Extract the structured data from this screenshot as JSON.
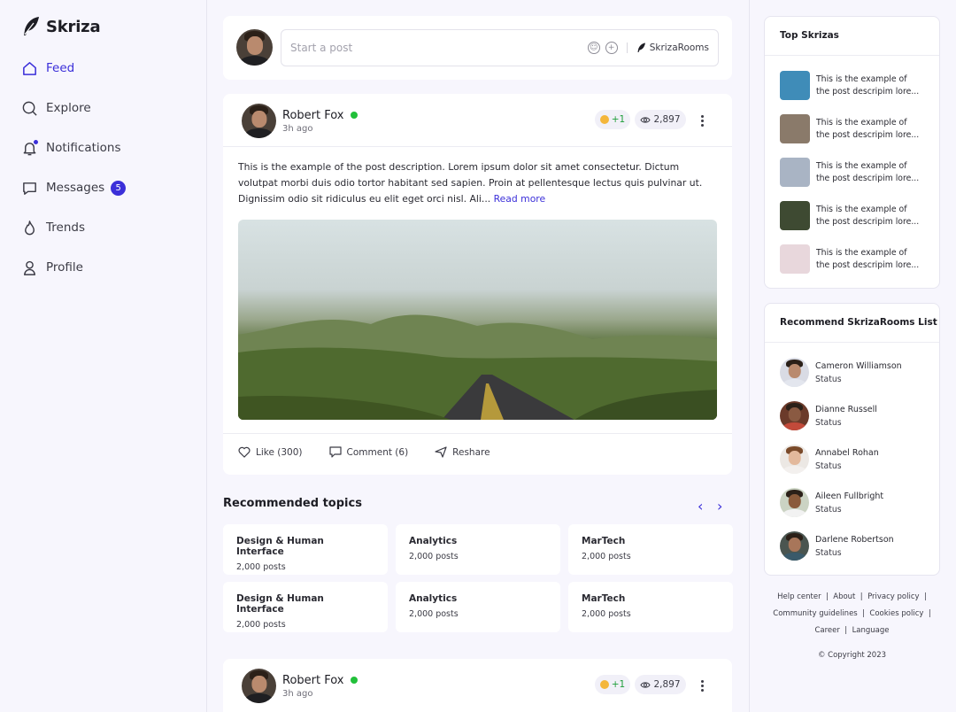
{
  "app": {
    "name": "Skriza"
  },
  "nav": {
    "items": [
      {
        "label": "Feed"
      },
      {
        "label": "Explore"
      },
      {
        "label": "Notifications"
      },
      {
        "label": "Messages",
        "badge": "5"
      },
      {
        "label": "Trends"
      },
      {
        "label": "Profile"
      }
    ]
  },
  "composer": {
    "placeholder": "Start a post",
    "rooms_label": "SkrizaRooms"
  },
  "posts": [
    {
      "author": "Robert Fox",
      "time": "3h ago",
      "reaction": "+1",
      "views": "2,897",
      "description": "This is the example of the post description. Lorem ipsum dolor sit amet consectetur. Dictum volutpat morbi duis odio tortor habitant sed sapien. Proin at pellentesque lectus quis pulvinar ut. Dignissim odio sit ridiculus eu elit eget orci nisl. Ali...",
      "read_more": "Read more",
      "like": "Like (300)",
      "comment": "Comment (6)",
      "reshare": "Reshare"
    },
    {
      "author": "Robert Fox",
      "time": "3h ago",
      "reaction": "+1",
      "views": "2,897"
    }
  ],
  "recommended": {
    "title": "Recommended topics",
    "topics": [
      {
        "name": "Design & Human Interface",
        "count": "2,000 posts"
      },
      {
        "name": "Analytics",
        "count": "2,000 posts"
      },
      {
        "name": "MarTech",
        "count": "2,000 posts"
      },
      {
        "name": "Design & Human Interface",
        "count": "2,000 posts"
      },
      {
        "name": "Analytics",
        "count": "2,000 posts"
      },
      {
        "name": "MarTech",
        "count": "2,000 posts"
      }
    ]
  },
  "top_skrizas": {
    "title": "Top Skrizas",
    "items": [
      {
        "text": "This is the example of the post descripim lore...",
        "color": "#3f8cb8"
      },
      {
        "text": "This is the example of the post descripim lore...",
        "color": "#8a7a6a"
      },
      {
        "text": "This is the example of the post descripim lore...",
        "color": "#a9b4c4"
      },
      {
        "text": "This is the example of the post descripim lore...",
        "color": "#3e4a32"
      },
      {
        "text": "This is the example of the post descripim lore...",
        "color": "#e8d7dc"
      }
    ]
  },
  "rooms": {
    "title": "Recommend SkrizaRooms List",
    "items": [
      {
        "name": "Cameron Williamson",
        "status": "Status"
      },
      {
        "name": "Dianne Russell",
        "status": "Status"
      },
      {
        "name": "Annabel Rohan",
        "status": "Status"
      },
      {
        "name": "Aileen Fullbright",
        "status": "Status"
      },
      {
        "name": "Darlene Robertson",
        "status": "Status"
      }
    ]
  },
  "footer": {
    "links": [
      "Help center",
      "About",
      "Privacy policy",
      "Community guidelines",
      "Cookies policy",
      "Career",
      "Language"
    ],
    "copyright": "© Copyright 2023"
  },
  "colors": {
    "accent": "#3b2fd9",
    "online": "#22c03a"
  }
}
